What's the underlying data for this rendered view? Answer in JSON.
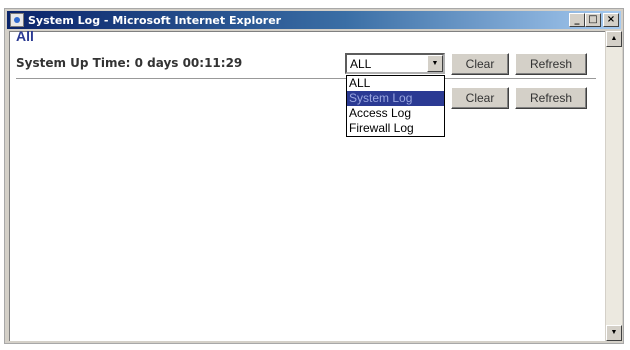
{
  "window": {
    "title": "System Log - Microsoft Internet Explorer",
    "minimize_label": "_",
    "maximize_label": "□",
    "close_label": "×"
  },
  "page": {
    "heading": "All",
    "uptime_text": "System Up Time: 0 days 00:11:29"
  },
  "log_select": {
    "selected_value": "ALL",
    "options": [
      "ALL",
      "System Log",
      "Access Log",
      "Firewall Log"
    ],
    "highlighted_option": "System Log"
  },
  "buttons": {
    "clear_label": "Clear",
    "refresh_label": "Refresh"
  },
  "icons": {
    "window_icon": "ie-icon",
    "dropdown_arrow": "chevron-down-icon",
    "scroll_up": "scroll-up-icon",
    "scroll_down": "scroll-down-icon"
  },
  "colors": {
    "heading": "#2b3a93",
    "titlebar_start": "#0a246a",
    "highlight": "#2b3a93"
  }
}
